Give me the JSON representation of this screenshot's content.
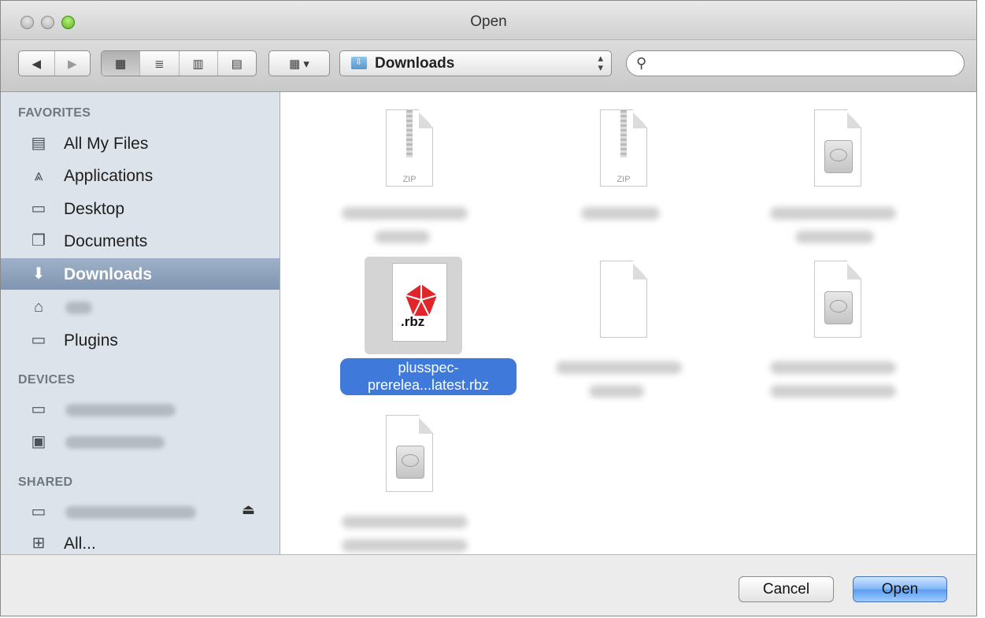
{
  "window": {
    "title": "Open"
  },
  "toolbar": {
    "nav_back": "◀",
    "nav_forward": "▶",
    "views": [
      "▦",
      "≣",
      "▥",
      "▤"
    ],
    "arrange_icon": "▦ ▾",
    "location": "Downloads",
    "location_arrows": "▲▼",
    "search": {
      "value": "",
      "placeholder": ""
    }
  },
  "sidebar": {
    "favorites_heading": "FAVORITES",
    "favorites": [
      {
        "label": "All My Files",
        "icon": "all-files-icon"
      },
      {
        "label": "Applications",
        "icon": "applications-icon"
      },
      {
        "label": "Desktop",
        "icon": "desktop-icon"
      },
      {
        "label": "Documents",
        "icon": "documents-icon"
      },
      {
        "label": "Downloads",
        "icon": "downloads-icon",
        "selected": true
      },
      {
        "label": "",
        "icon": "home-icon"
      },
      {
        "label": "Plugins",
        "icon": "folder-icon"
      }
    ],
    "devices_heading": "DEVICES",
    "shared_heading": "SHARED",
    "shared_all": "All..."
  },
  "files": {
    "selected_name_line1": "plusspec-",
    "selected_name_line2": "prerelea...latest.rbz",
    "rbz_ext": ".rbz",
    "zip_label": "ZIP"
  },
  "buttons": {
    "cancel": "Cancel",
    "open": "Open"
  }
}
